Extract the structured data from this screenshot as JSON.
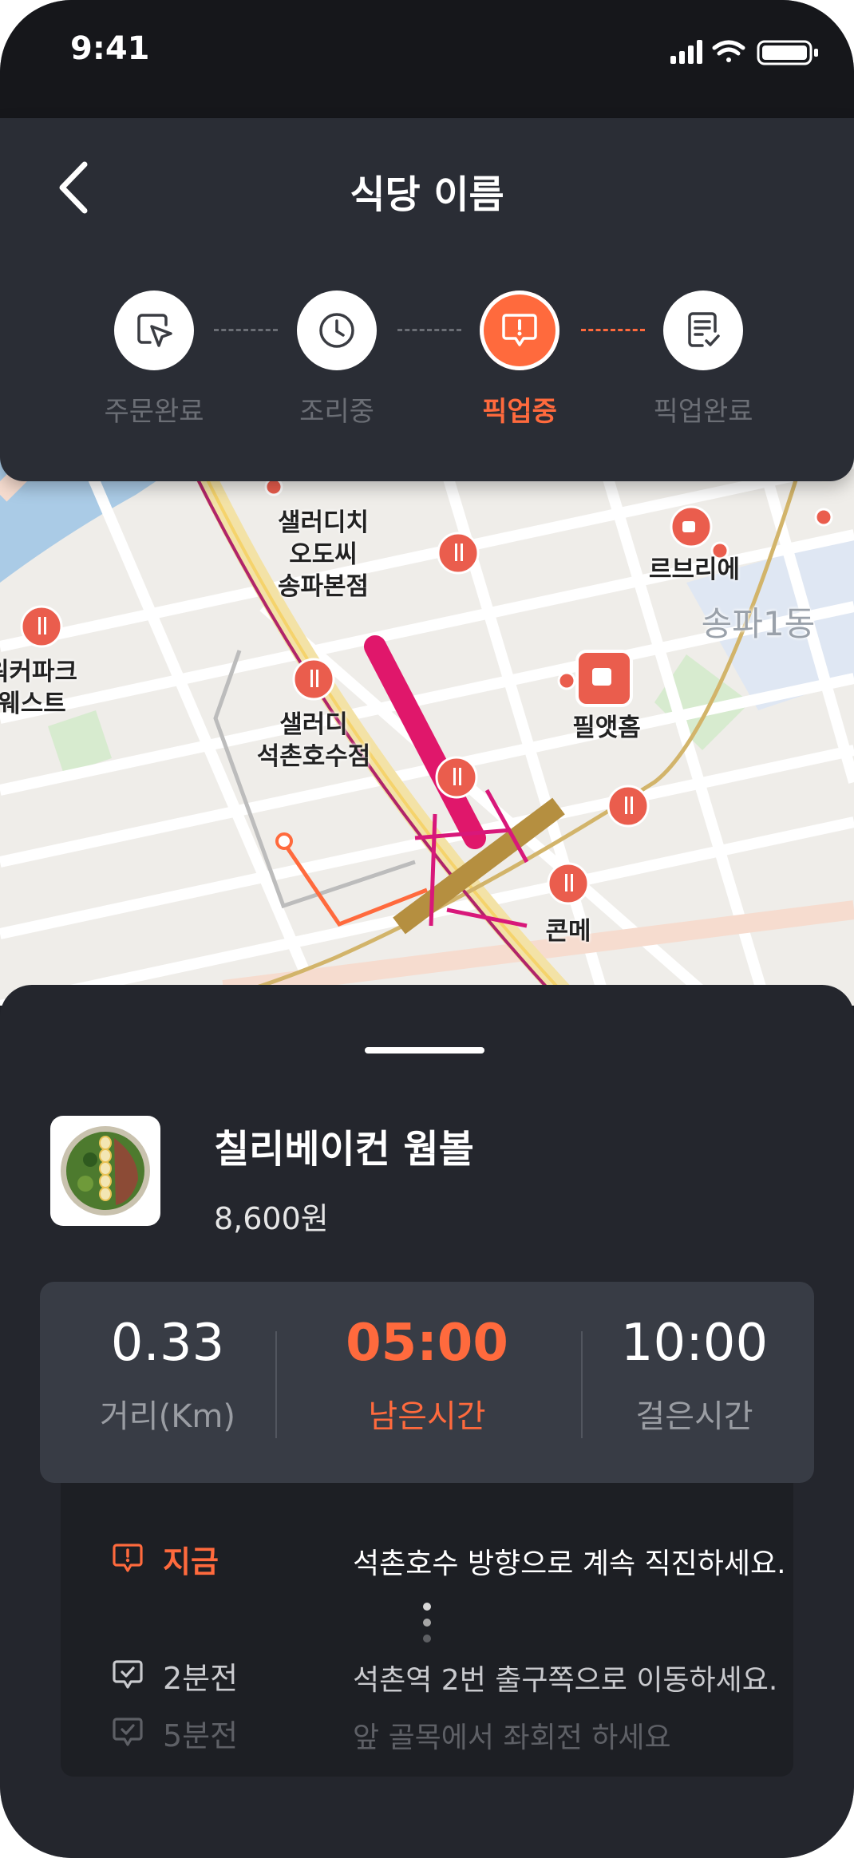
{
  "status": {
    "time": "9:41"
  },
  "header": {
    "title": "식당 이름"
  },
  "steps": [
    {
      "label": "주문완료",
      "icon": "cursor-click-icon",
      "active": false
    },
    {
      "label": "조리중",
      "icon": "clock-icon",
      "active": false
    },
    {
      "label": "픽업중",
      "icon": "alert-bubble-icon",
      "active": true
    },
    {
      "label": "픽업완료",
      "icon": "clipboard-check-icon",
      "active": false
    }
  ],
  "map": {
    "labels": {
      "salad_dich": "샐러디치\n오도씨\n송파본점",
      "le_brie": "르브리에",
      "songpa": "송파1동",
      "walker_park": "워커파크\n웨스트",
      "pill_home": "필앳홈",
      "saladi": "샐러디\n석촌호수점",
      "conme": "콘메"
    }
  },
  "product": {
    "name": "칠리베이컨 웜볼",
    "price": "8,600원"
  },
  "stats": [
    {
      "value": "0.33",
      "label": "거리(Km)"
    },
    {
      "value": "05:00",
      "label": "남은시간"
    },
    {
      "value": "10:00",
      "label": "걸은시간"
    }
  ],
  "guide": [
    {
      "time": "지금",
      "text": "석촌호수 방향으로 계속 직진하세요."
    },
    {
      "time": "2분전",
      "text": "석촌역 2번 출구쪽으로 이동하세요."
    },
    {
      "time": "5분전",
      "text": "앞 골목에서 좌회전 하세요"
    }
  ],
  "colors": {
    "accent": "#ff6a3d",
    "background": "#24262d",
    "header": "#2a2d35"
  }
}
